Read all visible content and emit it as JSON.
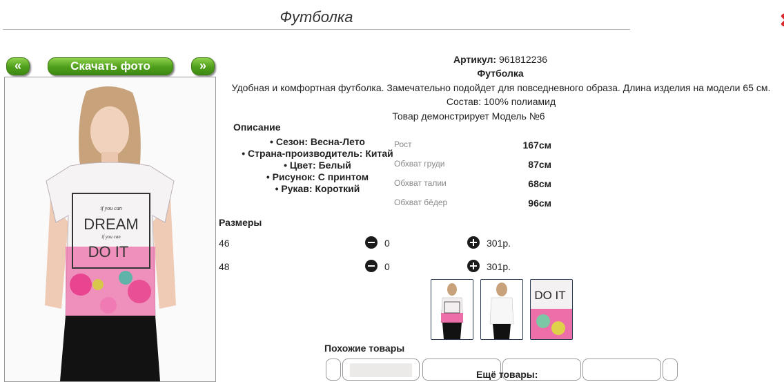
{
  "header": {
    "title": "Футболка"
  },
  "gallery": {
    "prev_label": "«",
    "download_label": "Скачать фото",
    "next_label": "»"
  },
  "product": {
    "sku_label": "Артикул:",
    "sku_value": "961812236",
    "name": "Футболка",
    "description": "Удобная и комфортная футболка. Замечательно подойдет для повседневного образа. Длина изделия на модели 65 см.",
    "composition": "Состав: 100% полиамид",
    "model_note": "Товар демонстрирует Модель №6",
    "print_lines": [
      "if you can",
      "DREAM",
      "if you can",
      "DO IT"
    ]
  },
  "description_section": {
    "heading": "Описание",
    "items": [
      "Сезон: Весна-Лето",
      "Страна-производитель: Китай",
      "Цвет: Белый",
      "Рисунок: С принтом",
      "Рукав: Короткий"
    ]
  },
  "measurements": [
    {
      "label": "Рост",
      "value": "167см"
    },
    {
      "label": "Обхват груди",
      "value": "87см"
    },
    {
      "label": "Обхват талии",
      "value": "68см"
    },
    {
      "label": "Обхват бёдер",
      "value": "96см"
    }
  ],
  "sizes": {
    "heading": "Размеры",
    "rows": [
      {
        "size": "46",
        "qty": "0",
        "price": "301р."
      },
      {
        "size": "48",
        "qty": "0",
        "price": "301р."
      }
    ]
  },
  "thumbnails": {
    "closeup_text": "DO IT"
  },
  "similar": {
    "heading": "Похожие товары"
  },
  "more": {
    "heading": "Ещё товары:"
  },
  "colors": {
    "accent_green": "#4e9e1b",
    "close_red": "#d9262b"
  }
}
